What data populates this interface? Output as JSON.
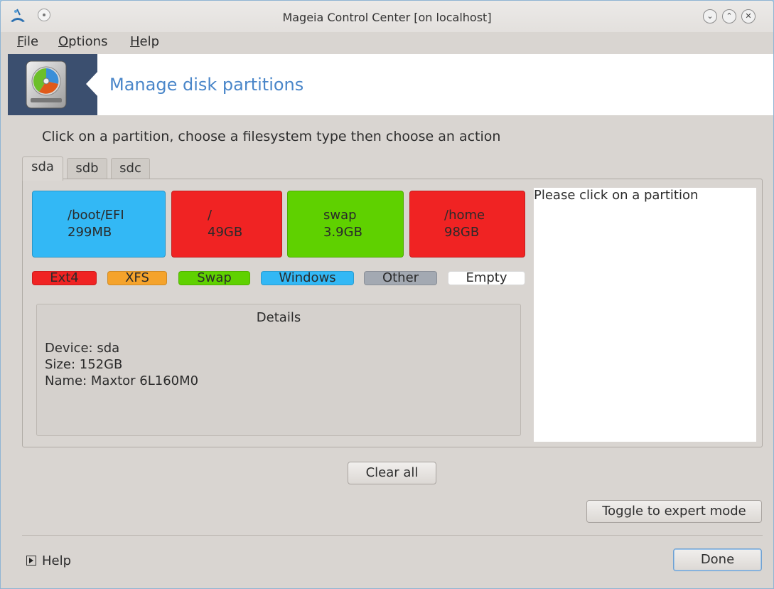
{
  "window": {
    "title": "Mageia Control Center  [on localhost]",
    "minimize_glyph": "⌄",
    "maximize_glyph": "⌃",
    "close_glyph": "✕"
  },
  "menu": {
    "file": {
      "accel": "F",
      "rest": "ile"
    },
    "options": {
      "accel": "O",
      "rest": "ptions"
    },
    "help": {
      "accel": "H",
      "rest": "elp"
    }
  },
  "header": {
    "title": "Manage disk partitions",
    "icon": "harddisk-icon"
  },
  "instruction": "Click on a partition, choose a filesystem type then choose an action",
  "tabs": [
    {
      "label": "sda",
      "active": true
    },
    {
      "label": "sdb",
      "active": false
    },
    {
      "label": "sdc",
      "active": false
    }
  ],
  "partitions": [
    {
      "mount": "/boot/EFI",
      "size": "299MB",
      "color": "#33b8f5"
    },
    {
      "mount": "/",
      "size": "49GB",
      "color": "#f02323"
    },
    {
      "mount": "swap",
      "size": "3.9GB",
      "color": "#5fd100"
    },
    {
      "mount": "/home",
      "size": "98GB",
      "color": "#f02323"
    }
  ],
  "legend": [
    {
      "label": "Ext4",
      "color": "#f02323"
    },
    {
      "label": "XFS",
      "color": "#f5a32b"
    },
    {
      "label": "Swap",
      "color": "#5fd100"
    },
    {
      "label": "Windows",
      "color": "#33b8f5"
    },
    {
      "label": "Other",
      "color": "#a3a9b2"
    },
    {
      "label": "Empty",
      "color": "#ffffff"
    }
  ],
  "details": {
    "title": "Details",
    "device": "Device: sda",
    "size": "Size: 152GB",
    "name": "Name: Maxtor 6L160M0"
  },
  "info_text": "Please click on a partition",
  "buttons": {
    "clear_all": "Clear all",
    "toggle_expert": "Toggle to expert mode",
    "help": "Help",
    "done": "Done"
  }
}
